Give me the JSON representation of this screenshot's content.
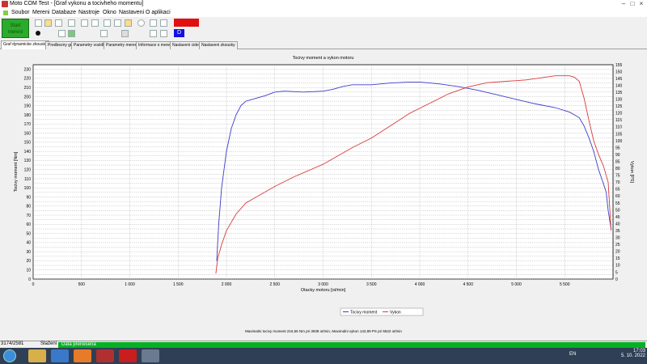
{
  "window": {
    "title": "Moto COM Test - [Graf vykonu a tocivheho momentu]",
    "controls": [
      "–",
      "□",
      "×"
    ]
  },
  "menu": [
    "Soubor",
    "Mereni",
    "Databaze",
    "Nastroje",
    "Okno",
    "Nastaveni",
    "O aplikaci"
  ],
  "toolbar": {
    "start_label": "Start\nmereni",
    "blue_label": "D"
  },
  "tabs": [
    "Graf dynamicke zkousky",
    "Predbezny graf",
    "Parametry vozidla",
    "Parametry mereni",
    "Informace o mereni",
    "Nastaveni cidel",
    "Nastaveni zkousky"
  ],
  "chart_data": {
    "type": "line",
    "title": "Tocivy moment a vykon motoru",
    "xlabel": "Otacky motoru [ot/min]",
    "ylabel": "Tocivy moment [Nm]",
    "y2label": "Vykon [PS]",
    "xlim": [
      0,
      6000
    ],
    "ylim": [
      0,
      235
    ],
    "y2lim": [
      0,
      155
    ],
    "x_ticks": [
      "0",
      "500",
      "1 000",
      "1 500",
      "2 000",
      "2 500",
      "3 000",
      "3 500",
      "4 000",
      "4 500",
      "5 000",
      "5 500"
    ],
    "y_ticks": [
      0,
      5,
      10,
      15,
      20,
      25,
      30,
      35,
      40,
      45,
      50,
      55,
      60,
      65,
      70,
      75,
      80,
      85,
      90,
      95,
      100,
      105,
      110,
      115,
      120,
      125,
      130,
      135,
      140,
      145,
      150,
      155,
      160,
      165,
      170,
      175,
      180,
      185,
      190,
      195,
      200,
      205,
      210,
      215,
      220,
      225,
      230
    ],
    "y2_ticks": [
      0,
      5,
      10,
      15,
      20,
      25,
      30,
      35,
      40,
      45,
      50,
      55,
      60,
      65,
      70,
      75,
      80,
      85,
      90,
      95,
      100,
      105,
      110,
      115,
      120,
      125,
      130,
      135,
      140,
      145,
      150,
      155
    ],
    "grid": true,
    "series": [
      {
        "name": "Tocivy moment",
        "axis": "left",
        "color": "#3c3ccc",
        "x": [
          1900,
          1920,
          1950,
          2000,
          2050,
          2100,
          2150,
          2200,
          2300,
          2400,
          2500,
          2600,
          2800,
          3000,
          3100,
          3200,
          3300,
          3500,
          3700,
          3900,
          4000,
          4200,
          4400,
          4600,
          4800,
          5000,
          5200,
          5400,
          5550,
          5600,
          5650,
          5700,
          5750,
          5800,
          5850,
          5900,
          5930,
          5950,
          5980
        ],
        "y": [
          20,
          60,
          100,
          140,
          165,
          180,
          190,
          195,
          198,
          201,
          205,
          206,
          205,
          206,
          208,
          211,
          213,
          213,
          215,
          216,
          216,
          214,
          211,
          207,
          202,
          197,
          192,
          188,
          183,
          180,
          177,
          168,
          155,
          140,
          120,
          105,
          95,
          75,
          55
        ]
      },
      {
        "name": "Vykon",
        "axis": "right",
        "color": "#d93a3a",
        "x": [
          1890,
          1910,
          1950,
          2000,
          2100,
          2200,
          2300,
          2500,
          2700,
          3000,
          3300,
          3500,
          3700,
          3900,
          4100,
          4300,
          4500,
          4700,
          4900,
          5100,
          5300,
          5400,
          5500,
          5550,
          5600,
          5650,
          5700,
          5750,
          5800,
          5850,
          5900,
          5950,
          5980
        ],
        "y": [
          4,
          15,
          25,
          35,
          47,
          55,
          59,
          67,
          74,
          83,
          95,
          102,
          111,
          120,
          127,
          134,
          139,
          142,
          143,
          144,
          146,
          147,
          147,
          147,
          146,
          143,
          131,
          115,
          100,
          90,
          82,
          70,
          35
        ]
      }
    ],
    "legend": {
      "position": "bottom-center",
      "entries": [
        "Tocivy moment",
        "Vykon"
      ]
    },
    "annotation": "Maximalni tocivy moment 216,55 Nm pri 3938 ot/min,  Maximalni vykon 142,89 PS pri 5522 ot/min"
  },
  "statusbar": {
    "left": "3174/2581",
    "state": "Stažení",
    "progress_text": "Data prenesena"
  },
  "taskbar": {
    "lang": "EN",
    "time": "17:03",
    "date": "5. 10. 2022"
  }
}
